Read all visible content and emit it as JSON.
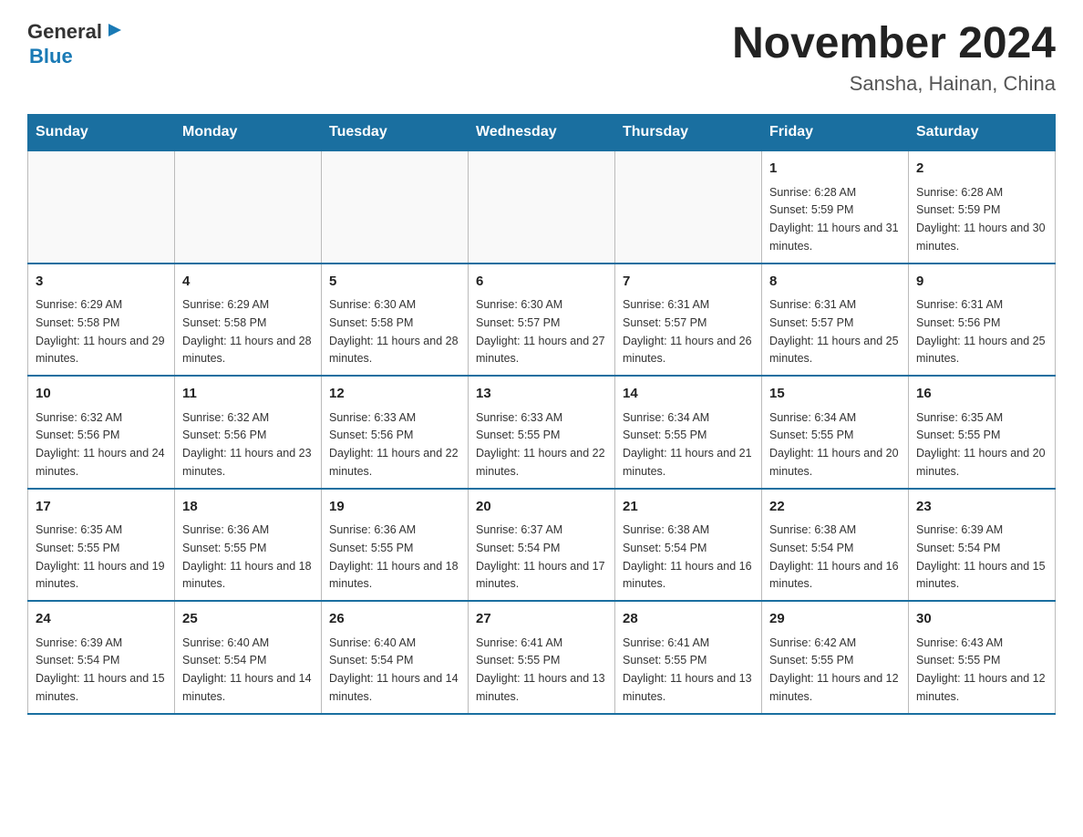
{
  "logo": {
    "general": "General",
    "arrow": "▶",
    "blue": "Blue"
  },
  "title": {
    "month": "November 2024",
    "location": "Sansha, Hainan, China"
  },
  "weekdays": [
    "Sunday",
    "Monday",
    "Tuesday",
    "Wednesday",
    "Thursday",
    "Friday",
    "Saturday"
  ],
  "weeks": [
    [
      {
        "day": "",
        "info": ""
      },
      {
        "day": "",
        "info": ""
      },
      {
        "day": "",
        "info": ""
      },
      {
        "day": "",
        "info": ""
      },
      {
        "day": "",
        "info": ""
      },
      {
        "day": "1",
        "info": "Sunrise: 6:28 AM\nSunset: 5:59 PM\nDaylight: 11 hours and 31 minutes."
      },
      {
        "day": "2",
        "info": "Sunrise: 6:28 AM\nSunset: 5:59 PM\nDaylight: 11 hours and 30 minutes."
      }
    ],
    [
      {
        "day": "3",
        "info": "Sunrise: 6:29 AM\nSunset: 5:58 PM\nDaylight: 11 hours and 29 minutes."
      },
      {
        "day": "4",
        "info": "Sunrise: 6:29 AM\nSunset: 5:58 PM\nDaylight: 11 hours and 28 minutes."
      },
      {
        "day": "5",
        "info": "Sunrise: 6:30 AM\nSunset: 5:58 PM\nDaylight: 11 hours and 28 minutes."
      },
      {
        "day": "6",
        "info": "Sunrise: 6:30 AM\nSunset: 5:57 PM\nDaylight: 11 hours and 27 minutes."
      },
      {
        "day": "7",
        "info": "Sunrise: 6:31 AM\nSunset: 5:57 PM\nDaylight: 11 hours and 26 minutes."
      },
      {
        "day": "8",
        "info": "Sunrise: 6:31 AM\nSunset: 5:57 PM\nDaylight: 11 hours and 25 minutes."
      },
      {
        "day": "9",
        "info": "Sunrise: 6:31 AM\nSunset: 5:56 PM\nDaylight: 11 hours and 25 minutes."
      }
    ],
    [
      {
        "day": "10",
        "info": "Sunrise: 6:32 AM\nSunset: 5:56 PM\nDaylight: 11 hours and 24 minutes."
      },
      {
        "day": "11",
        "info": "Sunrise: 6:32 AM\nSunset: 5:56 PM\nDaylight: 11 hours and 23 minutes."
      },
      {
        "day": "12",
        "info": "Sunrise: 6:33 AM\nSunset: 5:56 PM\nDaylight: 11 hours and 22 minutes."
      },
      {
        "day": "13",
        "info": "Sunrise: 6:33 AM\nSunset: 5:55 PM\nDaylight: 11 hours and 22 minutes."
      },
      {
        "day": "14",
        "info": "Sunrise: 6:34 AM\nSunset: 5:55 PM\nDaylight: 11 hours and 21 minutes."
      },
      {
        "day": "15",
        "info": "Sunrise: 6:34 AM\nSunset: 5:55 PM\nDaylight: 11 hours and 20 minutes."
      },
      {
        "day": "16",
        "info": "Sunrise: 6:35 AM\nSunset: 5:55 PM\nDaylight: 11 hours and 20 minutes."
      }
    ],
    [
      {
        "day": "17",
        "info": "Sunrise: 6:35 AM\nSunset: 5:55 PM\nDaylight: 11 hours and 19 minutes."
      },
      {
        "day": "18",
        "info": "Sunrise: 6:36 AM\nSunset: 5:55 PM\nDaylight: 11 hours and 18 minutes."
      },
      {
        "day": "19",
        "info": "Sunrise: 6:36 AM\nSunset: 5:55 PM\nDaylight: 11 hours and 18 minutes."
      },
      {
        "day": "20",
        "info": "Sunrise: 6:37 AM\nSunset: 5:54 PM\nDaylight: 11 hours and 17 minutes."
      },
      {
        "day": "21",
        "info": "Sunrise: 6:38 AM\nSunset: 5:54 PM\nDaylight: 11 hours and 16 minutes."
      },
      {
        "day": "22",
        "info": "Sunrise: 6:38 AM\nSunset: 5:54 PM\nDaylight: 11 hours and 16 minutes."
      },
      {
        "day": "23",
        "info": "Sunrise: 6:39 AM\nSunset: 5:54 PM\nDaylight: 11 hours and 15 minutes."
      }
    ],
    [
      {
        "day": "24",
        "info": "Sunrise: 6:39 AM\nSunset: 5:54 PM\nDaylight: 11 hours and 15 minutes."
      },
      {
        "day": "25",
        "info": "Sunrise: 6:40 AM\nSunset: 5:54 PM\nDaylight: 11 hours and 14 minutes."
      },
      {
        "day": "26",
        "info": "Sunrise: 6:40 AM\nSunset: 5:54 PM\nDaylight: 11 hours and 14 minutes."
      },
      {
        "day": "27",
        "info": "Sunrise: 6:41 AM\nSunset: 5:55 PM\nDaylight: 11 hours and 13 minutes."
      },
      {
        "day": "28",
        "info": "Sunrise: 6:41 AM\nSunset: 5:55 PM\nDaylight: 11 hours and 13 minutes."
      },
      {
        "day": "29",
        "info": "Sunrise: 6:42 AM\nSunset: 5:55 PM\nDaylight: 11 hours and 12 minutes."
      },
      {
        "day": "30",
        "info": "Sunrise: 6:43 AM\nSunset: 5:55 PM\nDaylight: 11 hours and 12 minutes."
      }
    ]
  ]
}
